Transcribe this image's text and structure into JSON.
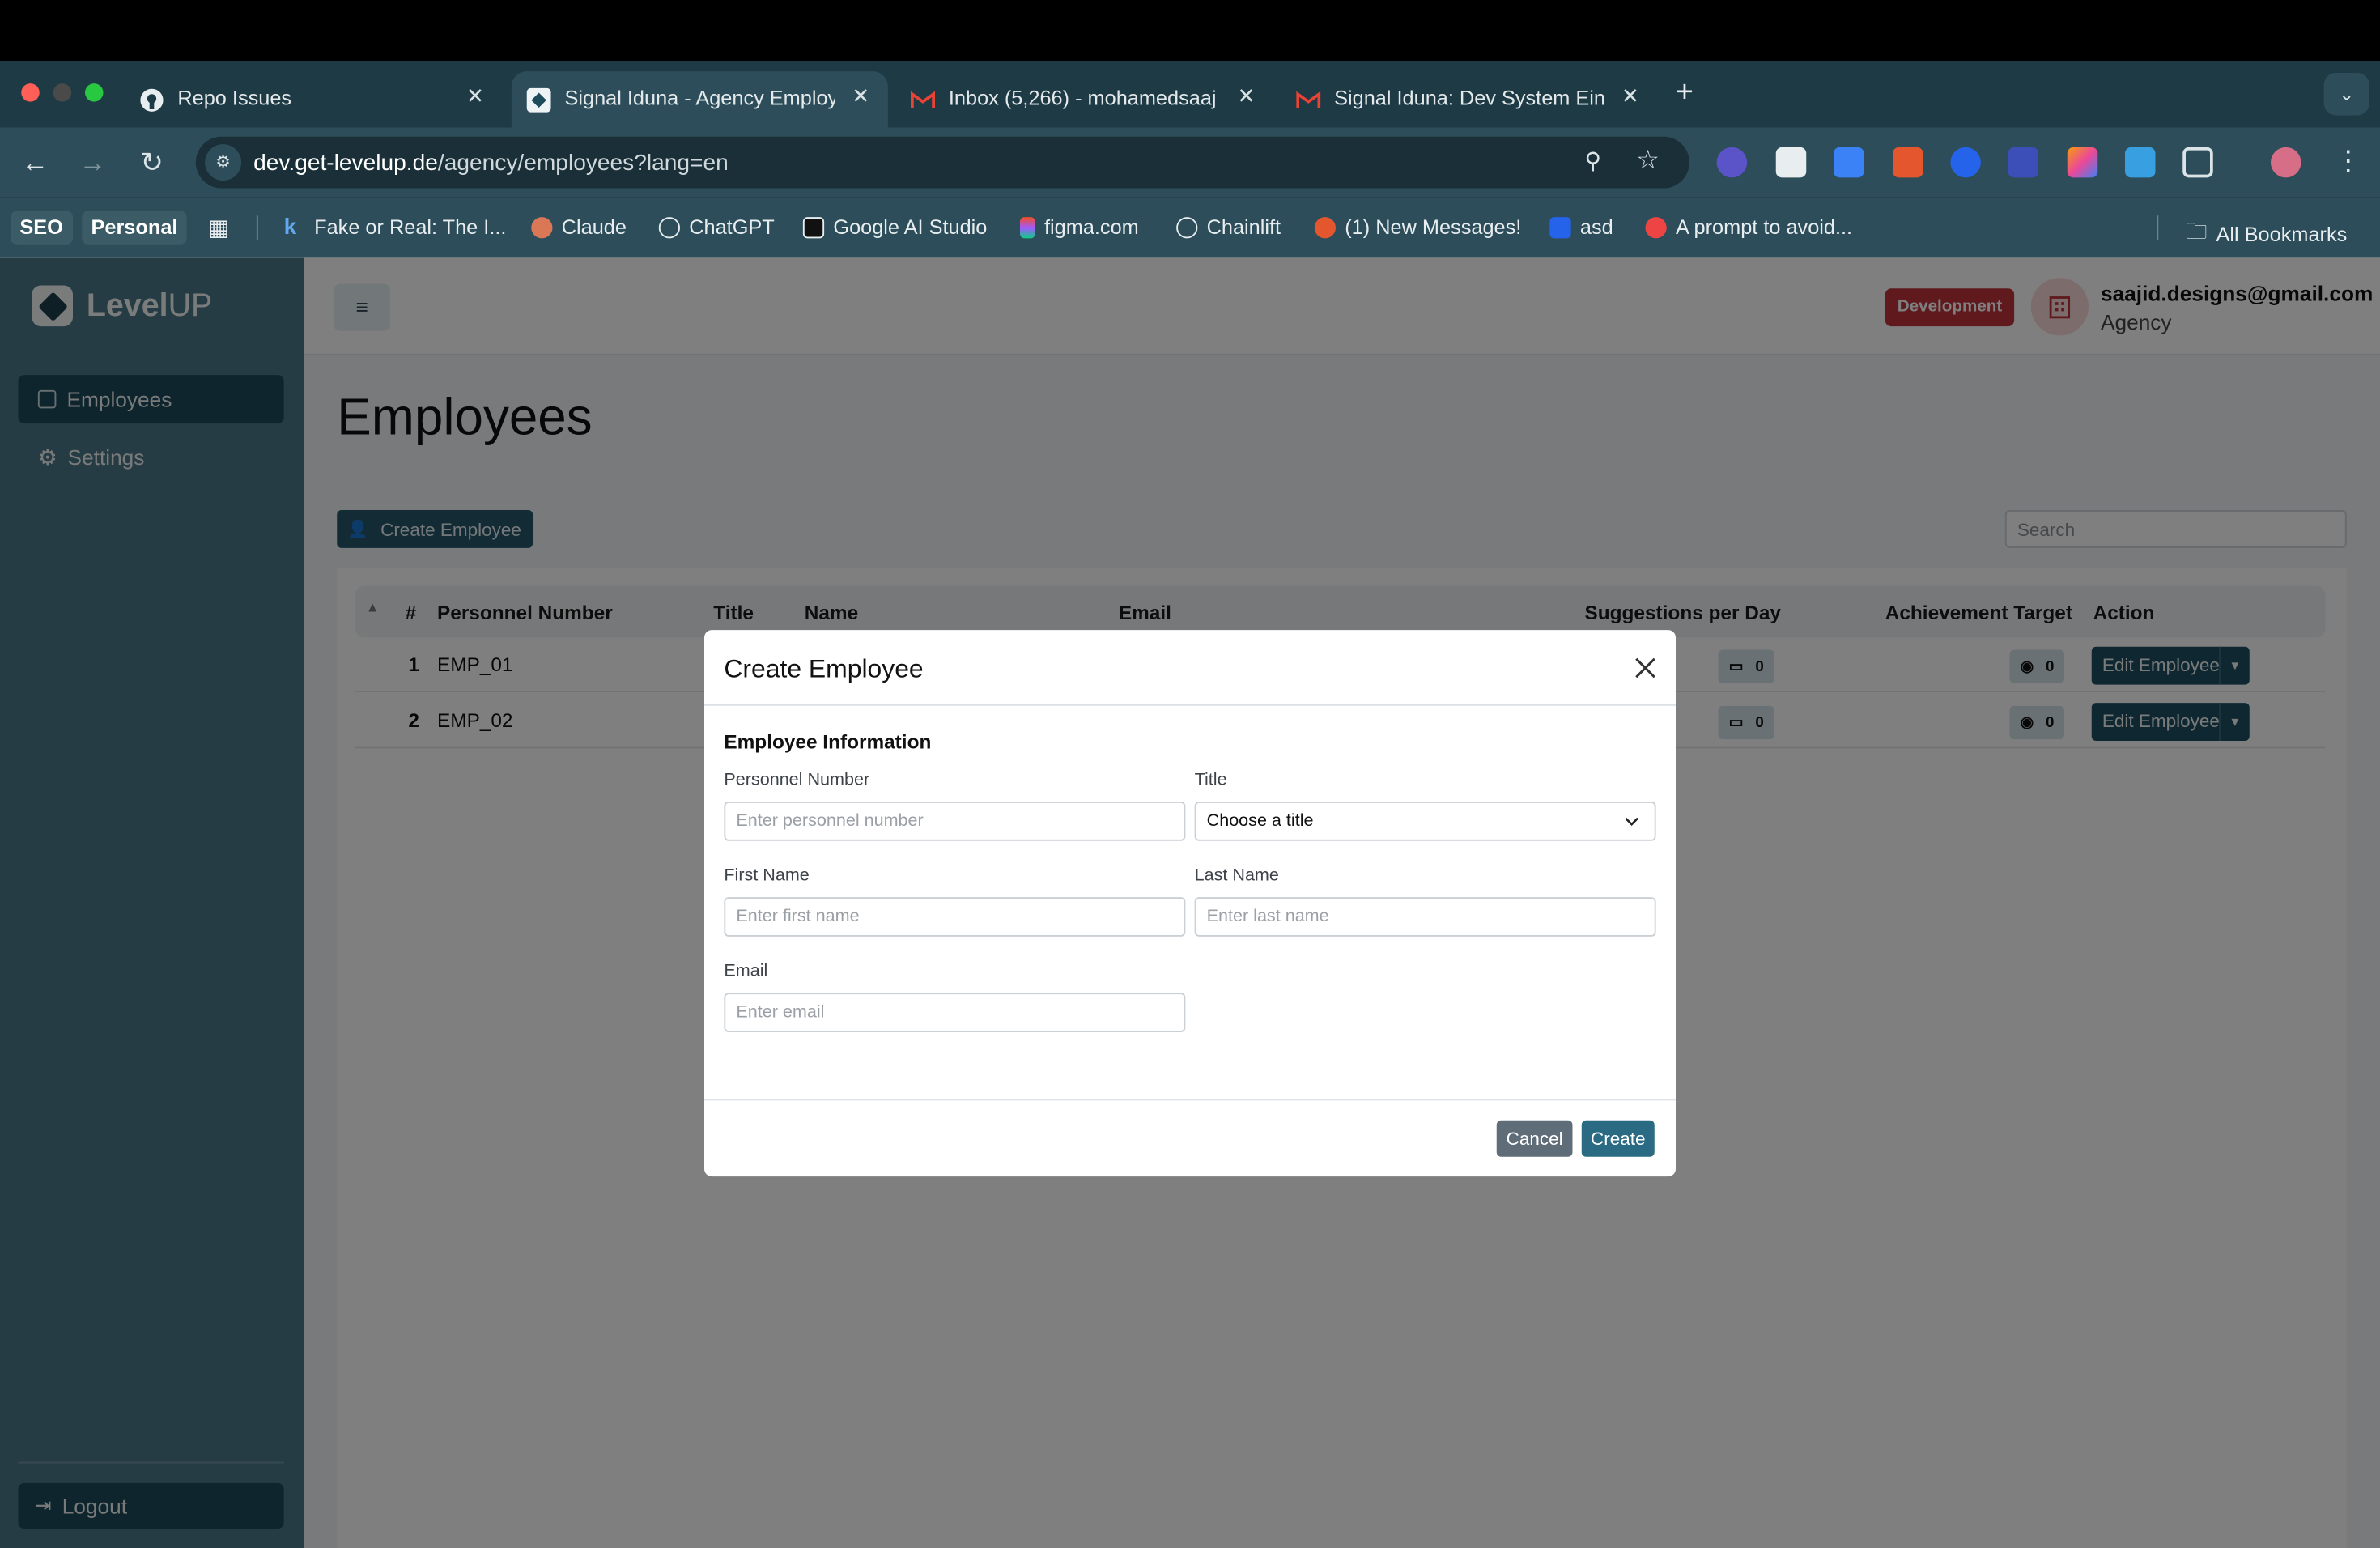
{
  "browser": {
    "tabs": [
      {
        "title": "Repo Issues",
        "active": false
      },
      {
        "title": "Signal Iduna - Agency Employ",
        "active": true
      },
      {
        "title": "Inbox (5,266) - mohamedsaaj",
        "active": false
      },
      {
        "title": "Signal Iduna: Dev System Ein",
        "active": false
      }
    ],
    "url_host": "dev.get-levelup.de",
    "url_path": "/agency/employees?lang=en",
    "bookmarks": [
      {
        "label": "Fake or Real: The I..."
      },
      {
        "label": "Claude"
      },
      {
        "label": "ChatGPT"
      },
      {
        "label": "Google AI Studio"
      },
      {
        "label": "figma.com"
      },
      {
        "label": "Chainlift"
      },
      {
        "label": "(1) New Messages!"
      },
      {
        "label": "asd"
      },
      {
        "label": "A prompt to avoid..."
      }
    ],
    "bookmark_chips": [
      "SEO",
      "Personal"
    ],
    "all_bookmarks": "All Bookmarks"
  },
  "app": {
    "logo_bold": "Level",
    "logo_rest": "UP",
    "sidebar": {
      "items": [
        {
          "label": "Employees",
          "active": true
        },
        {
          "label": "Settings",
          "active": false
        }
      ],
      "logout": "Logout"
    },
    "header": {
      "menu_icon": "≡",
      "env_badge": "Development",
      "user_email": "saajid.designs@gmail.com",
      "user_role": "Agency"
    },
    "page_title": "Employees",
    "create_button": "Create Employee",
    "search_placeholder": "Search",
    "table": {
      "columns": [
        "#",
        "Personnel Number",
        "Title",
        "Name",
        "Email",
        "Suggestions per Day",
        "Achievement Target",
        "Action"
      ],
      "rows": [
        {
          "index": "1",
          "personnel_number": "EMP_01",
          "suggestions": "0",
          "target": "0",
          "action": "Edit Employee"
        },
        {
          "index": "2",
          "personnel_number": "EMP_02",
          "suggestions": "0",
          "target": "0",
          "action": "Edit Employee"
        }
      ]
    }
  },
  "modal": {
    "title": "Create Employee",
    "section": "Employee Information",
    "fields": {
      "personnel_number": {
        "label": "Personnel Number",
        "placeholder": "Enter personnel number"
      },
      "title": {
        "label": "Title",
        "value": "Choose a title"
      },
      "first_name": {
        "label": "First Name",
        "placeholder": "Enter first name"
      },
      "last_name": {
        "label": "Last Name",
        "placeholder": "Enter last name"
      },
      "email": {
        "label": "Email",
        "placeholder": "Enter email"
      }
    },
    "cancel": "Cancel",
    "create": "Create"
  },
  "colors": {
    "brand_dark": "#1e4b5c",
    "sidebar": "#4d7889",
    "danger": "#c0343d",
    "primary_button": "#2a6a83"
  }
}
